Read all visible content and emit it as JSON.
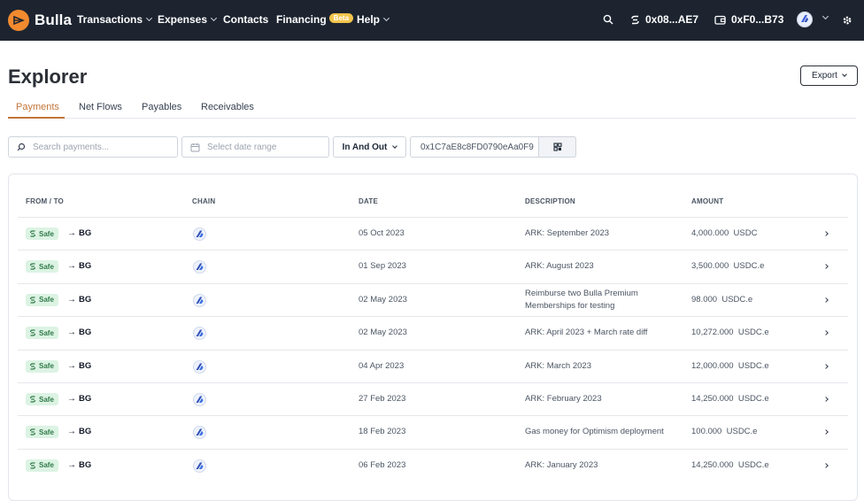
{
  "nav": {
    "brand": "Bulla",
    "items": [
      {
        "label": "Transactions",
        "has_menu": true
      },
      {
        "label": "Expenses",
        "has_menu": true
      },
      {
        "label": "Contacts",
        "has_menu": false
      },
      {
        "label": "Financing",
        "has_menu": false,
        "badge": "Beta"
      },
      {
        "label": "Help",
        "has_menu": true
      }
    ],
    "safe_address": "0x08...AE7",
    "wallet_address": "0xF0...B73",
    "icons": [
      "search-icon",
      "safe-icon",
      "wallet-icon",
      "network-icon",
      "gear-icon"
    ]
  },
  "page": {
    "title": "Explorer",
    "export_label": "Export"
  },
  "tabs": [
    "Payments",
    "Net Flows",
    "Payables",
    "Receivables"
  ],
  "active_tab": "Payments",
  "filters": {
    "search_placeholder": "Search payments...",
    "date_placeholder": "Select date range",
    "direction": "In And Out",
    "address": "0x1C7aE8c8FD0790eAa0F9"
  },
  "table": {
    "columns": [
      "FROM / TO",
      "CHAIN",
      "DATE",
      "DESCRIPTION",
      "AMOUNT"
    ],
    "rows": [
      {
        "from": "Safe",
        "to": "BG",
        "date": "05 Oct 2023",
        "description": "ARK: September 2023",
        "amount": "4,000.000",
        "token": "USDC"
      },
      {
        "from": "Safe",
        "to": "BG",
        "date": "01 Sep 2023",
        "description": "ARK: August 2023",
        "amount": "3,500.000",
        "token": "USDC.e"
      },
      {
        "from": "Safe",
        "to": "BG",
        "date": "02 May 2023",
        "description": "Reimburse two Bulla Premium Memberships for testing",
        "amount": "98.000",
        "token": "USDC.e"
      },
      {
        "from": "Safe",
        "to": "BG",
        "date": "02 May 2023",
        "description": "ARK: April 2023 + March rate diff",
        "amount": "10,272.000",
        "token": "USDC.e"
      },
      {
        "from": "Safe",
        "to": "BG",
        "date": "04 Apr 2023",
        "description": "ARK: March 2023",
        "amount": "12,000.000",
        "token": "USDC.e"
      },
      {
        "from": "Safe",
        "to": "BG",
        "date": "27 Feb 2023",
        "description": "ARK: February 2023",
        "amount": "14,250.000",
        "token": "USDC.e"
      },
      {
        "from": "Safe",
        "to": "BG",
        "date": "18 Feb 2023",
        "description": "Gas money for Optimism deployment",
        "amount": "100.000",
        "token": "USDC.e"
      },
      {
        "from": "Safe",
        "to": "BG",
        "date": "06 Feb 2023",
        "description": "ARK: January 2023",
        "amount": "14,250.000",
        "token": "USDC.e"
      }
    ]
  },
  "colors": {
    "nav_bg": "#1d2430",
    "brand_orange": "#f28a2e",
    "accent_tab": "#c2763a",
    "beta_badge": "#f3c44b",
    "safe_badge_bg": "#dcf3e3",
    "safe_badge_text": "#2f7a49"
  }
}
